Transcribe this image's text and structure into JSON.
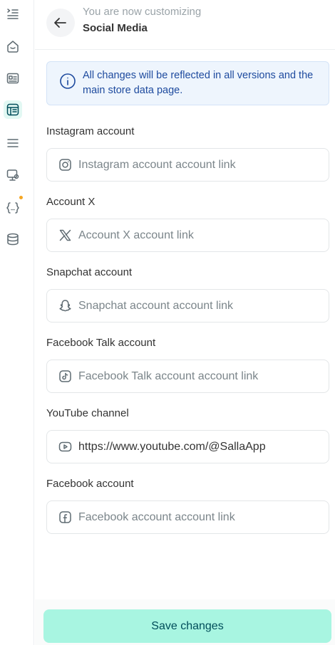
{
  "header": {
    "subtitle": "You are now customizing",
    "title": "Social Media"
  },
  "info": {
    "message": "All changes will be reflected in all versions and the main store data page."
  },
  "fields": [
    {
      "label": "Instagram account",
      "placeholder": "Instagram account account link",
      "value": "",
      "icon": "instagram-icon"
    },
    {
      "label": "Account X",
      "placeholder": "Account X account link",
      "value": "",
      "icon": "x-logo-icon"
    },
    {
      "label": "Snapchat account",
      "placeholder": "Snapchat account account link",
      "value": "",
      "icon": "snapchat-icon"
    },
    {
      "label": "Facebook Talk account",
      "placeholder": "Facebook Talk account account link",
      "value": "",
      "icon": "tiktok-icon"
    },
    {
      "label": "YouTube channel",
      "placeholder": "",
      "value": "https://www.youtube.com/@SallaApp",
      "icon": "youtube-icon"
    },
    {
      "label": "Facebook account",
      "placeholder": "Facebook account account link",
      "value": "",
      "icon": "facebook-icon"
    }
  ],
  "footer": {
    "save_label": "Save changes"
  },
  "sidebar": {
    "icons": [
      "menu-list-icon",
      "home-icon",
      "page-card-icon",
      "layout-icon",
      "list-icon",
      "monitor-settings-icon",
      "code-braces-icon",
      "database-icon"
    ],
    "active": "layout-icon",
    "notification_color": "#f5a623"
  },
  "colors": {
    "accent": "#a8f5e1",
    "accent_text": "#004d5a",
    "info_bg": "#eef5fd",
    "info_text": "#1d4a9e"
  }
}
